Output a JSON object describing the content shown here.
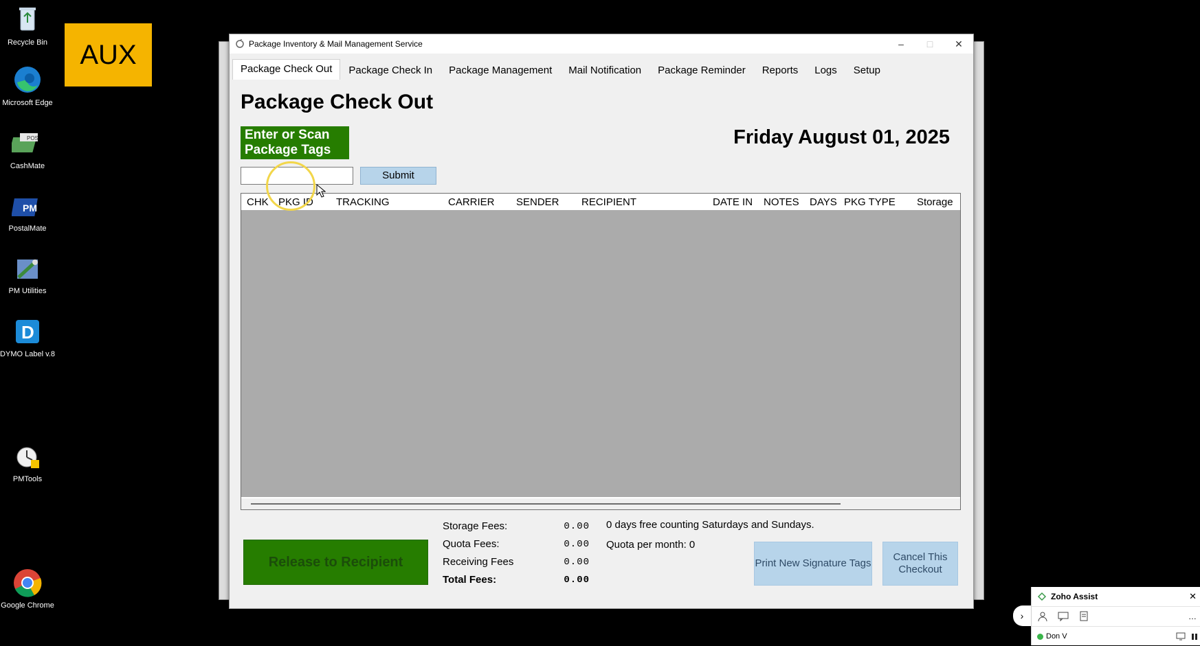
{
  "desktop": {
    "icons": [
      {
        "label": "Recycle Bin",
        "icon": "recycle-bin-icon"
      },
      {
        "label": "Microsoft Edge",
        "icon": "edge-icon"
      },
      {
        "label": "CashMate",
        "icon": "cashmate-icon"
      },
      {
        "label": "PostalMate",
        "icon": "postalmate-icon"
      },
      {
        "label": "PM Utilities",
        "icon": "pm-utilities-icon"
      },
      {
        "label": "DYMO Label v.8",
        "icon": "dymo-icon"
      },
      {
        "label": "PMTools",
        "icon": "pmtools-icon"
      },
      {
        "label": "Google Chrome",
        "icon": "chrome-icon"
      }
    ],
    "aux_tile": "AUX"
  },
  "window": {
    "title": "Package Inventory & Mail Management Service",
    "controls": {
      "minimize": "–",
      "maximize": "□",
      "close": "✕"
    }
  },
  "tabs": [
    {
      "label": "Package Check Out",
      "active": true
    },
    {
      "label": "Package Check In",
      "active": false
    },
    {
      "label": "Package Management",
      "active": false
    },
    {
      "label": "Mail Notification",
      "active": false
    },
    {
      "label": "Package Reminder",
      "active": false
    },
    {
      "label": "Reports",
      "active": false
    },
    {
      "label": "Logs",
      "active": false
    },
    {
      "label": "Setup",
      "active": false
    }
  ],
  "checkout": {
    "page_title": "Package Check Out",
    "scan_label": "Enter or Scan Package Tags",
    "date": "Friday August 01, 2025",
    "scan_input_value": "",
    "submit_label": "Submit",
    "columns": [
      "CHK",
      "PKG ID",
      "TRACKING",
      "CARRIER",
      "SENDER",
      "RECIPIENT",
      "DATE IN",
      "NOTES",
      "DAYS",
      "PKG TYPE",
      "Storage"
    ],
    "rows": [],
    "release_label": "Release to Recipient",
    "fees": {
      "storage_label": "Storage Fees:",
      "storage_value": "0.00",
      "quota_label": "Quota Fees:",
      "quota_value": "0.00",
      "receiving_label": "Receiving Fees",
      "receiving_value": "0.00",
      "total_label": "Total Fees:",
      "total_value": "0.00"
    },
    "free_days_note": "0 days free counting Saturdays and Sundays.",
    "quota_note": "Quota per month: 0",
    "print_tags_label": "Print New Signature Tags",
    "cancel_label": "Cancel This Checkout"
  },
  "zoho": {
    "title": "Zoho Assist",
    "close": "✕",
    "user": "Don V",
    "more": "…",
    "expand": "›"
  },
  "colors": {
    "green": "#267d00",
    "light_blue": "#b7d4ea",
    "grid_gray": "#ababab",
    "aux_yellow": "#f5b400"
  }
}
